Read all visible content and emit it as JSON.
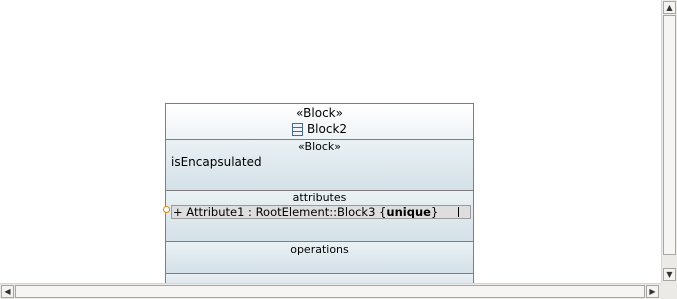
{
  "block": {
    "stereotype": "«Block»",
    "name": "Block2",
    "icon": "block-icon"
  },
  "stereotype_compartment": {
    "title": "«Block»",
    "property": "isEncapsulated"
  },
  "attributes_compartment": {
    "title": "attributes",
    "attribute": {
      "prefix": "+ Attribute1 : RootElement::Block3 {",
      "modifier": "unique",
      "suffix": "}"
    }
  },
  "operations_compartment": {
    "title": "operations"
  },
  "scrollbars": {
    "up_arrow": "▲",
    "down_arrow": "▼",
    "left_arrow": "◀",
    "right_arrow": "▶"
  }
}
